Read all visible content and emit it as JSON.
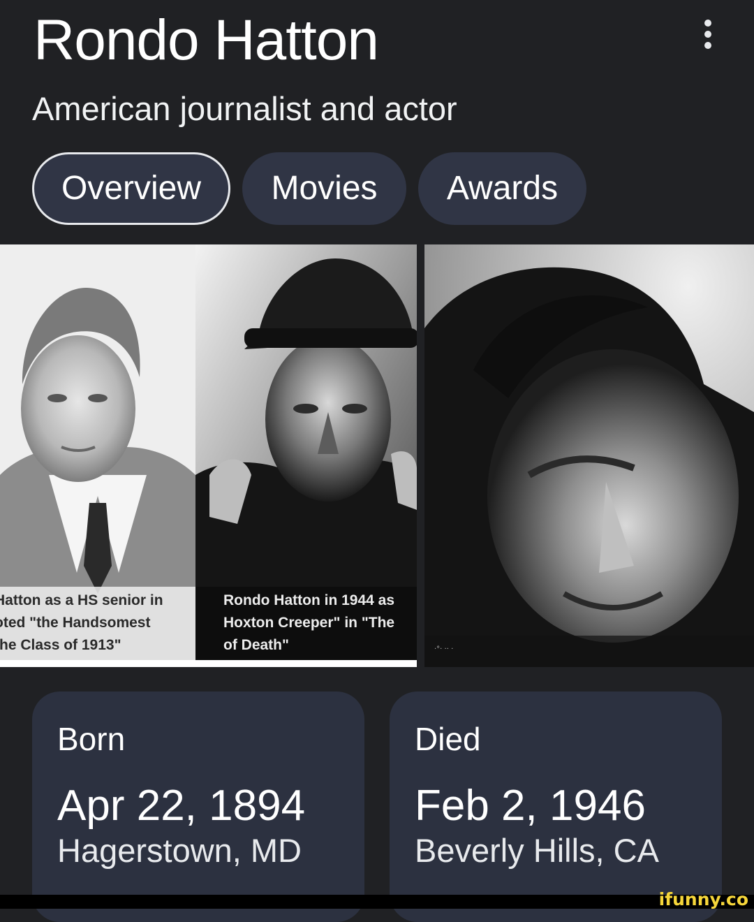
{
  "header": {
    "title": "Rondo Hatton",
    "subtitle": "American journalist and actor",
    "menu_icon": "more-vert-icon"
  },
  "tabs": [
    {
      "label": "Overview",
      "active": true
    },
    {
      "label": "Movies",
      "active": false
    },
    {
      "label": "Awards",
      "active": false
    }
  ],
  "images": {
    "left": {
      "caption_left": [
        "Hatton as a HS senior in",
        "oted \"the Handsomest",
        "the Class of 1913\""
      ],
      "caption_right": [
        "Rondo Hatton in 1944 as",
        "Hoxton Creeper\" in \"The",
        "of Death\""
      ]
    },
    "right": {
      "stamp": "·°· ·· ·"
    }
  },
  "facts": {
    "born": {
      "label": "Born",
      "date": "Apr 22, 1894",
      "place": "Hagerstown, MD"
    },
    "died": {
      "label": "Died",
      "date": "Feb 2, 1946",
      "place": "Beverly Hills, CA"
    }
  },
  "watermark": "ifunny.co",
  "colors": {
    "background": "#202124",
    "chip": "#303545",
    "card": "#2c3140",
    "watermark": "#f6d63a"
  }
}
